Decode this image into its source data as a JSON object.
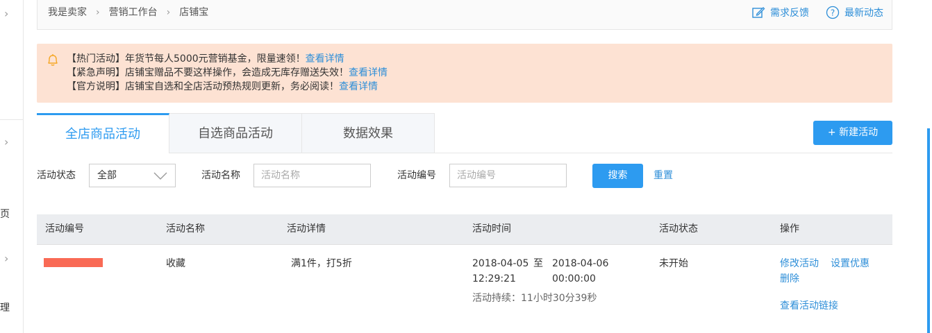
{
  "breadcrumb": {
    "items": [
      "我是卖家",
      "营销工作台",
      "店铺宝"
    ]
  },
  "header_links": {
    "feedback": "需求反馈",
    "news": "最新动态"
  },
  "sidebar": {
    "fragments": [
      "页",
      "理"
    ]
  },
  "notice": {
    "lines": [
      {
        "text": "【热门活动】年货节每人5000元营销基金，限量速领！",
        "link": "查看详情"
      },
      {
        "text": "【紧急声明】店铺宝赠品不要这样操作，会造成无库存赠送失效！",
        "link": "查看详情"
      },
      {
        "text": "【官方说明】店铺宝自选和全店活动预热规则更新，务必阅读！",
        "link": "查看详情"
      }
    ]
  },
  "tabs": {
    "items": [
      "全店商品活动",
      "自选商品活动",
      "数据效果"
    ],
    "active": 0
  },
  "new_button": "+ 新建活动",
  "filters": {
    "status_label": "活动状态",
    "status_value": "全部",
    "name_label": "活动名称",
    "name_placeholder": "活动名称",
    "id_label": "活动编号",
    "id_placeholder": "活动编号",
    "search": "搜索",
    "reset": "重置"
  },
  "table": {
    "headers": [
      "活动编号",
      "活动名称",
      "活动详情",
      "活动时间",
      "活动状态",
      "操作"
    ],
    "rows": [
      {
        "name": "收藏",
        "detail": "满1件，打5折",
        "start_date": "2018-04-05",
        "start_time": "12:29:21",
        "to": "至",
        "end_date": "2018-04-06",
        "end_time": "00:00:00",
        "duration": "活动持续：11小时30分39秒",
        "status": "未开始",
        "actions": {
          "edit": "修改活动",
          "set_discount": "设置优惠",
          "delete": "删除",
          "view_link": "查看活动链接"
        }
      }
    ]
  },
  "colors": {
    "accent": "#2d9bf0",
    "link": "#2d8ed8",
    "notice_bg": "#fde2d3",
    "redacted": "#f96a55"
  }
}
